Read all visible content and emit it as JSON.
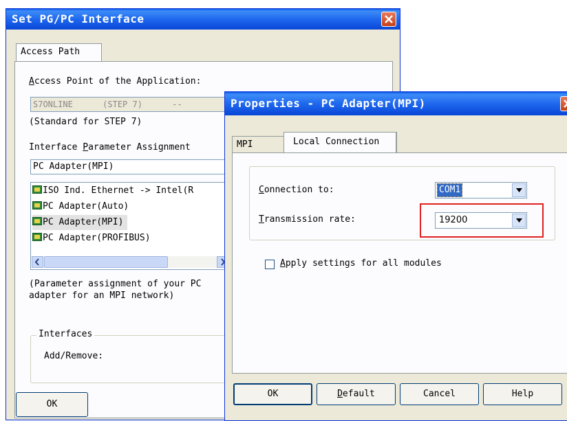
{
  "back_window": {
    "title": "Set PG/PC Interface",
    "tab": "Access Path",
    "access_point_label": "Access Point of the Application:",
    "access_point_value": "S7ONLINE      (STEP 7)      --",
    "access_point_note": "(Standard for STEP 7)",
    "param_label": "Interface Parameter Assignment",
    "param_value": "PC Adapter(MPI)",
    "list_items": [
      "ISO Ind. Ethernet -> Intel(R",
      "PC Adapter(Auto)",
      "PC Adapter(MPI)",
      "PC Adapter(PROFIBUS)"
    ],
    "description": "(Parameter assignment of your PC\nadapter for an MPI network)",
    "interfaces_group": "Interfaces",
    "add_remove": "Add/Remove:",
    "ok_label": "OK"
  },
  "front_window": {
    "title": "Properties - PC Adapter(MPI)",
    "tabs": [
      "MPI",
      "Local Connection"
    ],
    "connection_label": "Connection to:",
    "connection_value": "COM1",
    "rate_label": "Transmission rate:",
    "rate_value": "19200",
    "apply_label": "Apply settings for all modules",
    "apply_checked": false,
    "buttons": {
      "ok": "OK",
      "default": "Default",
      "cancel": "Cancel",
      "help": "Help"
    }
  },
  "colors": {
    "highlight_box": "#e02020",
    "titlebar": "#0a58e8"
  }
}
